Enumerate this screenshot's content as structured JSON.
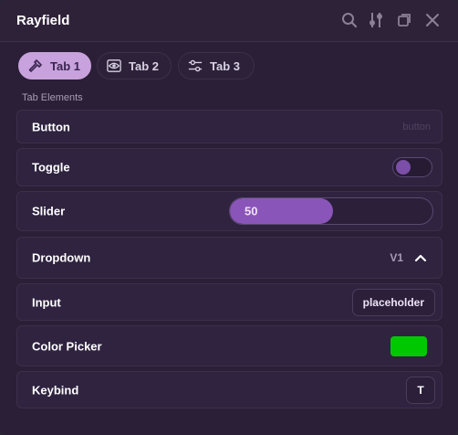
{
  "window": {
    "title": "Rayfield"
  },
  "topbar": {
    "icons": [
      "search-icon",
      "settings-sliders-icon",
      "minimize-icon",
      "close-icon"
    ]
  },
  "tabs": [
    {
      "label": "Tab 1",
      "icon": "hammer-icon",
      "active": true
    },
    {
      "label": "Tab 2",
      "icon": "eye-icon",
      "active": false
    },
    {
      "label": "Tab 3",
      "icon": "sliders-icon",
      "active": false
    }
  ],
  "section": {
    "title": "Tab Elements"
  },
  "elements": {
    "button": {
      "label": "Button",
      "hint": "button"
    },
    "toggle": {
      "label": "Toggle",
      "value": false,
      "accent": "#7b4fa8"
    },
    "slider": {
      "label": "Slider",
      "value": "50",
      "fill_fraction": 0.51,
      "accent": "#8a55b8"
    },
    "dropdown": {
      "label": "Dropdown",
      "selected": "V1",
      "expanded": true
    },
    "input": {
      "label": "Input",
      "placeholder": "placeholder"
    },
    "color_picker": {
      "label": "Color Picker",
      "color": "#00c800"
    },
    "keybind": {
      "label": "Keybind",
      "key": "T"
    }
  },
  "theme": {
    "background": "#2a1f36",
    "row_background": "#2f2340",
    "active_tab": "#c8a2dc",
    "text": "#ffffff",
    "muted_text": "#a89cb6"
  }
}
